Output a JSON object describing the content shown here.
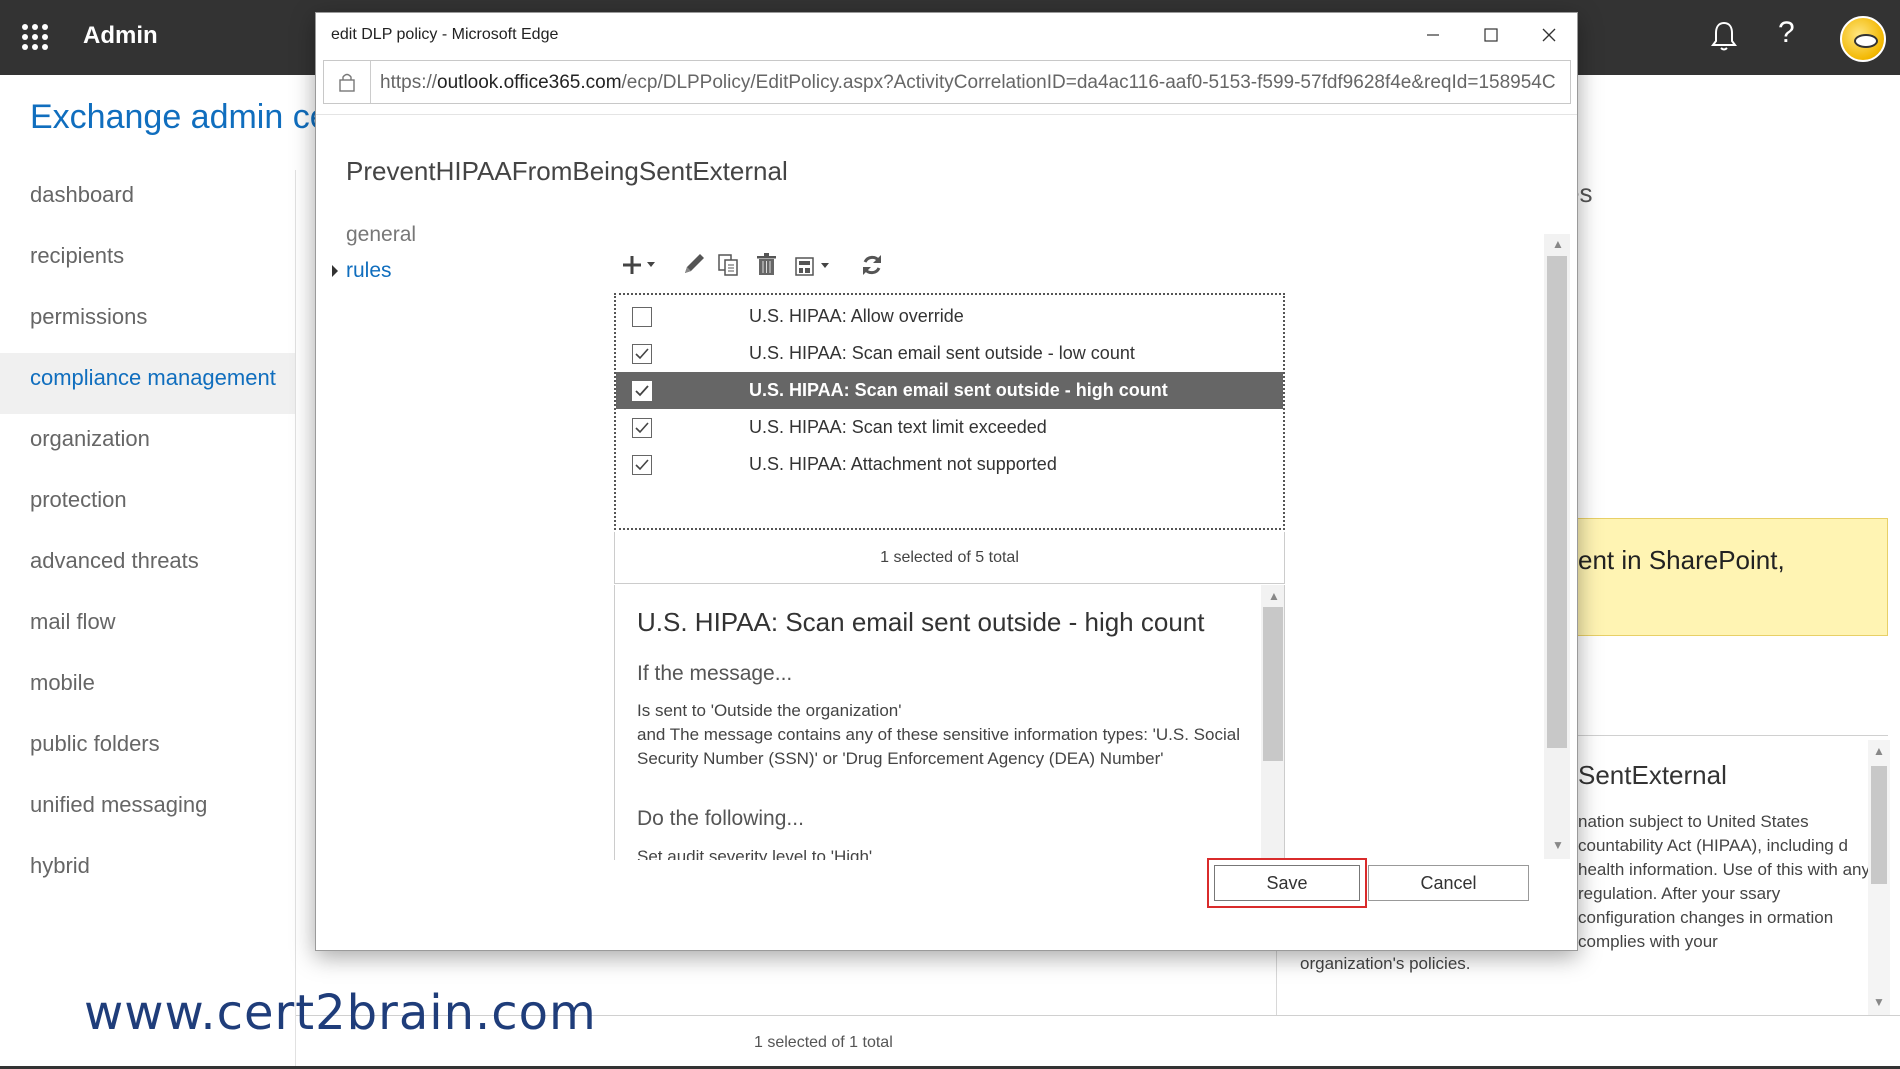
{
  "shell": {
    "app_title": "Admin",
    "help_glyph": "?",
    "icons": [
      "waffle-icon",
      "bell-icon",
      "help-icon",
      "avatar"
    ]
  },
  "eac": {
    "title": "Exchange admin cer",
    "nav": [
      {
        "label": "dashboard"
      },
      {
        "label": "recipients"
      },
      {
        "label": "permissions"
      },
      {
        "label": "compliance management",
        "active": true
      },
      {
        "label": "organization"
      },
      {
        "label": "protection"
      },
      {
        "label": "advanced threats"
      },
      {
        "label": "mail flow"
      },
      {
        "label": "mobile"
      },
      {
        "label": "public folders"
      },
      {
        "label": "unified messaging"
      },
      {
        "label": "hybrid"
      }
    ],
    "bg_fragment_es": "es",
    "bg_yellow_text": "ent in SharePoint,",
    "bg_detail_title": "SentExternal",
    "bg_detail_desc": "nation subject to United States countability Act (HIPAA), including d health information. Use of this with any regulation. After your ssary configuration changes in ormation complies with your",
    "bg_detail_tail": "organization's policies.",
    "bg_bottom_count": "1 selected of 1 total",
    "watermark": "www.cert2brain.com"
  },
  "popup": {
    "window_title": "edit DLP policy - Microsoft Edge",
    "url_prefix": "https://",
    "url_host": "outlook.office365.com",
    "url_path": "/ecp/DLPPolicy/EditPolicy.aspx?ActivityCorrelationID=da4ac116-aaf0-5153-f599-57fdf9628f4e&reqId=158954C",
    "policy_name": "PreventHIPAAFromBeingSentExternal",
    "sections": {
      "general": "general",
      "rules": "rules"
    },
    "toolbar": [
      "add-icon",
      "edit-icon",
      "copy-icon",
      "delete-icon",
      "priority-icon",
      "refresh-icon"
    ],
    "rules": [
      {
        "name": "U.S. HIPAA: Allow override",
        "checked": false,
        "selected": false
      },
      {
        "name": "U.S. HIPAA: Scan email sent outside - low count",
        "checked": true,
        "selected": false
      },
      {
        "name": "U.S. HIPAA: Scan email sent outside - high count",
        "checked": true,
        "selected": true
      },
      {
        "name": "U.S. HIPAA: Scan text limit exceeded",
        "checked": true,
        "selected": false
      },
      {
        "name": "U.S. HIPAA: Attachment not supported",
        "checked": true,
        "selected": false
      }
    ],
    "selection_count": "1 selected of 5 total",
    "detail": {
      "title": "U.S. HIPAA: Scan email sent outside - high count",
      "if_heading": "If the message...",
      "condition_1": "Is sent to 'Outside the organization'",
      "condition_2": "and The message contains any of these sensitive information types: 'U.S. Social Security Number (SSN)' or 'Drug Enforcement Agency (DEA) Number'",
      "do_heading": "Do the following...",
      "action_1": "Set audit severity level to 'High'"
    },
    "buttons": {
      "save": "Save",
      "cancel": "Cancel"
    },
    "colors": {
      "accent": "#106ebe",
      "selected_row": "#666666",
      "highlight": "#d92b2b"
    }
  }
}
